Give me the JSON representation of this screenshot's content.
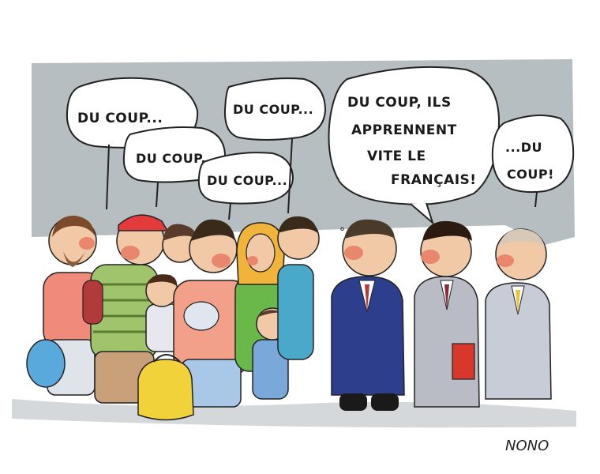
{
  "bubbles": {
    "b1": "DU COUP...",
    "b2": "DU COUP...",
    "b3": "DU COUP...",
    "b4": "DU COUP...",
    "b5": {
      "line1": "DU COUP, ILS",
      "line2": "APPRENNENT",
      "line3": "VITE LE",
      "line4": "FRANÇAIS!"
    },
    "b6": {
      "line1": "...DU",
      "line2": "COUP!"
    }
  },
  "signature": "NONO",
  "colors": {
    "sky": "#a9b3b7",
    "ground": "#b8bec1",
    "suit_navy": "#2c3e8c",
    "suit_grey": "#b9bcc4",
    "suit_light": "#c7ccd6",
    "skin": "#f2c9a7",
    "face_red": "#e9866e",
    "hijab": "#f0b43a",
    "bag_blue": "#5aa9dd",
    "bag_yellow": "#f2d23a",
    "folder_red": "#d8372c"
  }
}
